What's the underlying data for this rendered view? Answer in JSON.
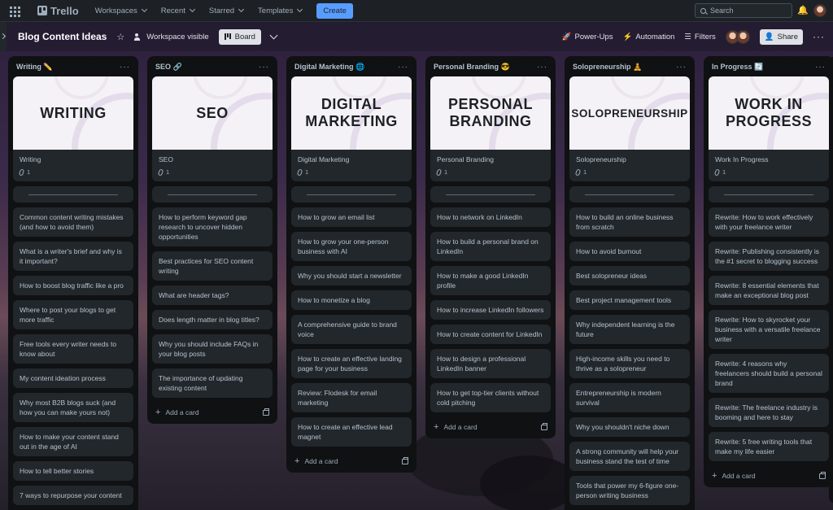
{
  "topnav": {
    "logo": "Trello",
    "menus": [
      "Workspaces",
      "Recent",
      "Starred",
      "Templates"
    ],
    "create_label": "Create",
    "search_placeholder": "Search"
  },
  "board": {
    "title": "Blog Content Ideas",
    "visibility": "Workspace visible",
    "view_label": "Board",
    "powerups_label": "Power-Ups",
    "automation_label": "Automation",
    "filters_label": "Filters",
    "share_label": "Share"
  },
  "add_card_label": "Add a card",
  "lists": [
    {
      "title": "Writing ✏️",
      "cover": "WRITING",
      "cover_title": "Writing",
      "attachments": "1",
      "cards": [
        "Common content writing mistakes (and how to avoid them)",
        "What is a writer's brief and why is it important?",
        "How to boost blog traffic like a pro",
        "Where to post your blogs to get more traffic",
        "Free tools every writer needs to know about",
        "My content ideation process",
        "Why most B2B blogs suck (and how you can make yours not)",
        "How to make your content stand out in the age of AI",
        "How to tell better stories",
        "7 ways to repurpose your content"
      ]
    },
    {
      "title": "SEO 🔗",
      "cover": "SEO",
      "cover_title": "SEO",
      "attachments": "1",
      "cards": [
        "How to perform keyword gap research to uncover hidden opportunities",
        "Best practices for SEO content writing",
        "What are header tags?",
        "Does length matter in blog titles?",
        "Why you should include FAQs in your blog posts",
        "The importance of updating existing content"
      ]
    },
    {
      "title": "Digital Marketing 🌐",
      "cover": "DIGITAL MARKETING",
      "cover_title": "Digital Marketing",
      "attachments": "1",
      "cards": [
        "How to grow an email list",
        "How to grow your one-person business with AI",
        "Why you should start a newsletter",
        "How to monetize a blog",
        "A comprehensive guide to brand voice",
        "How to create an effective landing page for your business",
        "Review: Flodesk for email marketing",
        "How to create an effective lead magnet"
      ]
    },
    {
      "title": "Personal Branding 😎",
      "cover": "PERSONAL BRANDING",
      "cover_title": "Personal Branding",
      "attachments": "1",
      "cards": [
        "How to network on LinkedIn",
        "How to build a personal brand on LinkedIn",
        "How to make a good LinkedIn profile",
        "How to increase LinkedIn followers",
        "How to create content for LinkedIn",
        "How to design a professional LinkedIn banner",
        "How to get top-tier clients without cold pitching"
      ]
    },
    {
      "title": "Solopreneurship 🧘",
      "cover": "SOLOPRENEURSHIP",
      "cover_title": "Solopreneurship",
      "attachments": "1",
      "cards": [
        "How to build an online business from scratch",
        "How to avoid burnout",
        "Best solopreneur ideas",
        "Best project management tools",
        "Why independent learning is the future",
        "High-income skills you need to thrive as a solopreneur",
        "Entrepreneurship is modern survival",
        "Why you shouldn't niche down",
        "A strong community will help your business stand the test of time",
        "Tools that power my 6-figure one-person writing business"
      ]
    },
    {
      "title": "In Progress 🔄",
      "cover": "WORK IN PROGRESS",
      "cover_title": "Work In Progress",
      "attachments": "1",
      "cards": [
        "Rewrite: How to work effectively with your freelance writer",
        "Rewrite: Publishing consistently is the #1 secret to blogging success",
        "Rewrite: 8 essential elements that make an exceptional blog post",
        "Rewrite: How to skyrocket your business with a versatile freelance writer",
        "Rewrite: 4 reasons why freelancers should build a personal brand",
        "Rewrite: The freelance industry is booming and here to stay",
        "Rewrite: 5 free writing tools that make my life easier"
      ]
    }
  ]
}
